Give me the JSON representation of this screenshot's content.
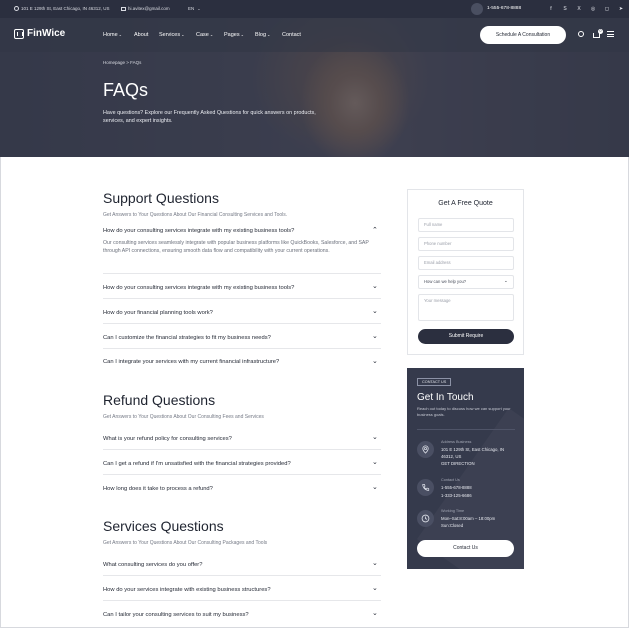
{
  "topbar": {
    "address": "101 E 129th St, East Chicago, IN 46312, US",
    "email": "hi.avitex@gmail.com",
    "language": "EN",
    "phone": "1-555-678-8888",
    "social_icons": [
      "facebook-icon",
      "skype-icon",
      "x-icon",
      "instagram-icon",
      "chat-icon",
      "telegram-icon"
    ]
  },
  "header": {
    "logo": "FinWice",
    "nav": [
      {
        "label": "Home",
        "dropdown": true
      },
      {
        "label": "About",
        "dropdown": false
      },
      {
        "label": "Services",
        "dropdown": true
      },
      {
        "label": "Case",
        "dropdown": true
      },
      {
        "label": "Pages",
        "dropdown": true
      },
      {
        "label": "Blog",
        "dropdown": true
      },
      {
        "label": "Contact",
        "dropdown": false
      }
    ],
    "cta": "Schedule A Consultation",
    "cart_count": "0"
  },
  "hero": {
    "breadcrumb": "Homepage  >  FAQs",
    "title": "FAQs",
    "subtitle": "Have questions? Explore our Frequently Asked Questions for quick answers on products, services, and expert insights."
  },
  "faq": {
    "support": {
      "title": "Support Questions",
      "subtitle": "Get Answers to Your Questions About Our Financial Consulting Services and Tools.",
      "items": [
        {
          "q": "How do your consulting services integrate with my existing business tools?",
          "open": true,
          "a": "Our consulting services seamlessly integrate with popular business platforms like QuickBooks, Salesforce, and SAP through API connections, ensuring smooth data flow and compatibility with your current operations."
        },
        {
          "q": "How do your consulting services integrate with my existing business tools?"
        },
        {
          "q": "How do your financial planning tools work?"
        },
        {
          "q": "Can I customize the financial strategies to fit my business needs?"
        },
        {
          "q": "Can I integrate your services with my current financial infrastructure?"
        }
      ]
    },
    "refund": {
      "title": "Refund Questions",
      "subtitle": "Get Answers to Your Questions About Our Consulting Fees and Services",
      "items": [
        {
          "q": "What is your refund policy for consulting services?"
        },
        {
          "q": "Can I get a refund if I'm unsatisfied with the financial strategies provided?"
        },
        {
          "q": "How long does it take to process a refund?"
        }
      ]
    },
    "services": {
      "title": "Services Questions",
      "subtitle": "Get Answers to Your Questions About Our Consulting Packages and Tools",
      "items": [
        {
          "q": "What consulting services do you offer?"
        },
        {
          "q": "How do your services integrate with existing business structures?"
        },
        {
          "q": "Can I tailor your consulting services to suit my business?"
        }
      ]
    }
  },
  "quote": {
    "title": "Get A Free Quote",
    "full_name": "Full name",
    "phone": "Phone number",
    "email": "Email address",
    "help_select": "How can we help you?",
    "message": "Your message",
    "submit": "Submit Require"
  },
  "contact": {
    "badge": "CONTACT US",
    "title": "Get In Touch",
    "subtitle": "Reach out today to discuss how we can support your business goals.",
    "address_label": "Address Business",
    "address_lines": [
      "101 E 129th St, East Chicago, IN",
      "46312, US",
      "GET DIRECTION"
    ],
    "contact_label": "Contact Us",
    "contact_lines": [
      "1-555-678-8888",
      "1-333-125-6686"
    ],
    "time_label": "Working Time",
    "time_lines": [
      "Mon–Sat:8:00am – 18:00pm",
      "Sun:Closed"
    ],
    "button": "Contact Us"
  }
}
